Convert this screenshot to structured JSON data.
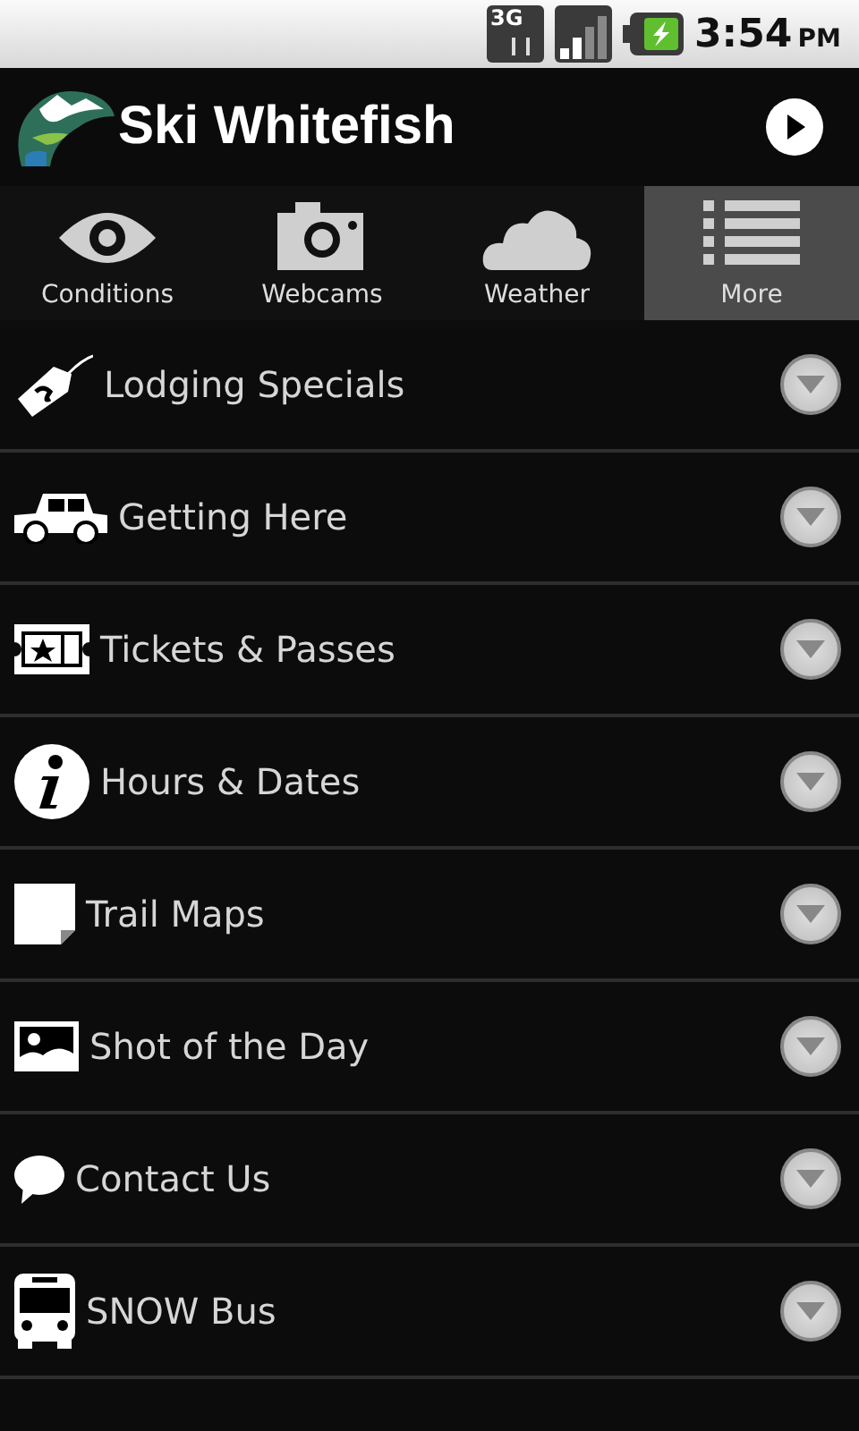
{
  "status_bar": {
    "network": "3G",
    "time": "3:54",
    "meridiem": "PM"
  },
  "header": {
    "title": "Ski Whitefish"
  },
  "tabs": [
    {
      "label": "Conditions",
      "kind": "eye",
      "selected": false
    },
    {
      "label": "Webcams",
      "kind": "camera",
      "selected": false
    },
    {
      "label": "Weather",
      "kind": "cloud",
      "selected": false
    },
    {
      "label": "More",
      "kind": "list",
      "selected": true
    }
  ],
  "items": [
    {
      "label": "Lodging Specials",
      "kind": "tag"
    },
    {
      "label": "Getting Here",
      "kind": "car"
    },
    {
      "label": "Tickets & Passes",
      "kind": "ticket"
    },
    {
      "label": "Hours & Dates",
      "kind": "info"
    },
    {
      "label": "Trail Maps",
      "kind": "page"
    },
    {
      "label": "Shot of the Day",
      "kind": "image"
    },
    {
      "label": "Contact Us",
      "kind": "chat"
    },
    {
      "label": "SNOW Bus",
      "kind": "bus"
    }
  ]
}
